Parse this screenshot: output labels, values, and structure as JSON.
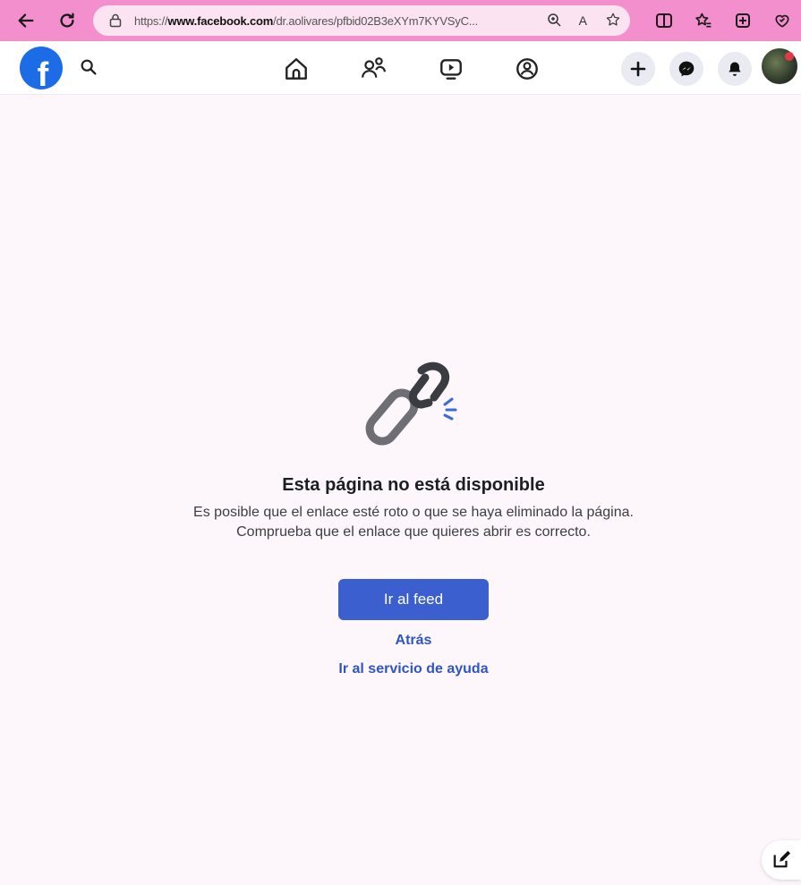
{
  "browser": {
    "url_prefix": "https://",
    "url_domain": "www.facebook.com",
    "url_rest": "/dr.aolivares/pfbid02B3eXYm7KYVSyC...",
    "read_aloud_label": "A"
  },
  "header": {
    "logo_letter": "f"
  },
  "error": {
    "title": "Esta página no está disponible",
    "description": "Es posible que el enlace esté roto o que se haya eliminado la página. Comprueba que el enlace que quieres abrir es correcto.",
    "feed_button": "Ir al feed",
    "back_link": "Atrás",
    "help_link": "Ir al servicio de ayuda"
  },
  "icons": {
    "back": "back-arrow-icon",
    "reload": "reload-icon",
    "lock": "lock-icon",
    "zoom": "zoom-icon",
    "favorite": "star-icon",
    "split": "split-screen-icon",
    "favorites": "favorites-icon",
    "collections": "collections-icon",
    "extensions": "heart-extension-icon",
    "search": "search-icon",
    "home": "home-icon",
    "friends": "friends-icon",
    "watch": "video-icon",
    "groups": "groups-icon",
    "create": "plus-icon",
    "messenger": "messenger-icon",
    "notifications": "bell-icon",
    "compose": "compose-icon"
  },
  "colors": {
    "browser_bar": "#f28fcc",
    "fb_blue": "#1c6ce8",
    "button_blue": "#3b5fcf",
    "link_blue": "#2e55c8",
    "page_bg": "#fdf6fb"
  }
}
